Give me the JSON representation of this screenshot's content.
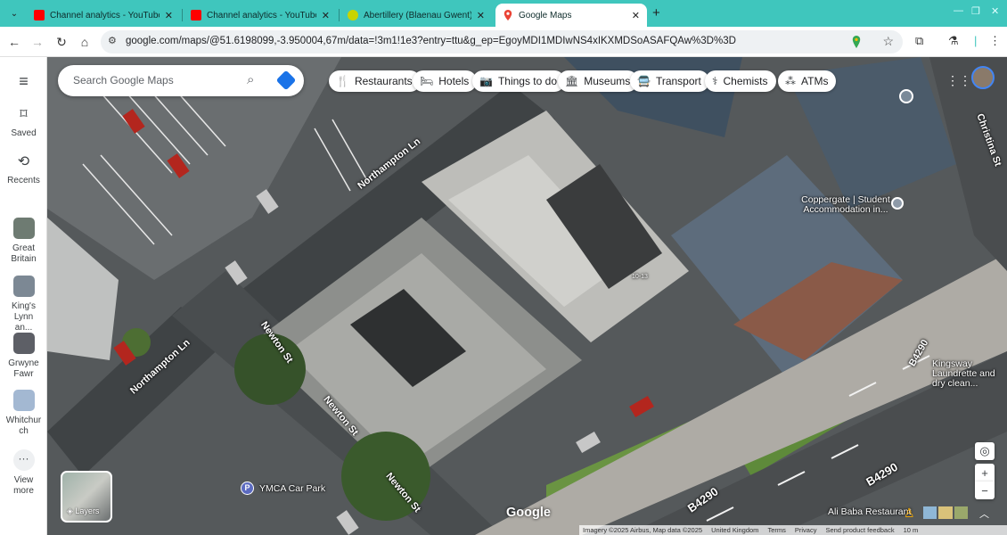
{
  "browser": {
    "tabs": [
      {
        "title": "Channel analytics - YouTube St",
        "favicon": "youtube-icon"
      },
      {
        "title": "Channel analytics - YouTube St",
        "favicon": "youtube-icon"
      },
      {
        "title": "Abertillery (Blaenau Gwent) we",
        "favicon": "weather-icon"
      },
      {
        "title": "Google Maps",
        "favicon": "maps-pin-icon",
        "active": true
      }
    ],
    "url": "google.com/maps/@51.6198099,-3.950004,67m/data=!3m1!1e3?entry=ttu&g_ep=EgoyMDI1MDIwNS4xIKXMDSoASAFQAw%3D%3D",
    "accent": "#3fc6bd"
  },
  "rail": {
    "saved": "Saved",
    "recents": "Recents",
    "places": [
      "Great Britain",
      "King's Lynn an...",
      "Grwyne Fawr",
      "Whitchurch"
    ],
    "view_more": "View more"
  },
  "search": {
    "placeholder": "Search Google Maps"
  },
  "chips": [
    "Restaurants",
    "Hotels",
    "Things to do",
    "Museums",
    "Transport",
    "Chemists",
    "ATMs"
  ],
  "map": {
    "streets": [
      "Northampton Ln",
      "Northampton Ln",
      "Newton St",
      "Newton St",
      "Newton St",
      "B4290",
      "B4290",
      "B4290",
      "Christina St"
    ],
    "pois": {
      "coppergate": "Coppergate | Student Accommodation in...",
      "kingsway": "Kingsway Laundrette and dry clean...",
      "alibaba": "Ali Baba Restaurant",
      "ymca": "YMCA Car Park",
      "parking_letter": "P",
      "building_number": "10-13"
    },
    "layers_label": "Layers",
    "logo": "Google",
    "footer": [
      "Imagery ©2025 Airbus, Map data ©2025",
      "United Kingdom",
      "Terms",
      "Privacy",
      "Send product feedback",
      "10 m"
    ]
  }
}
